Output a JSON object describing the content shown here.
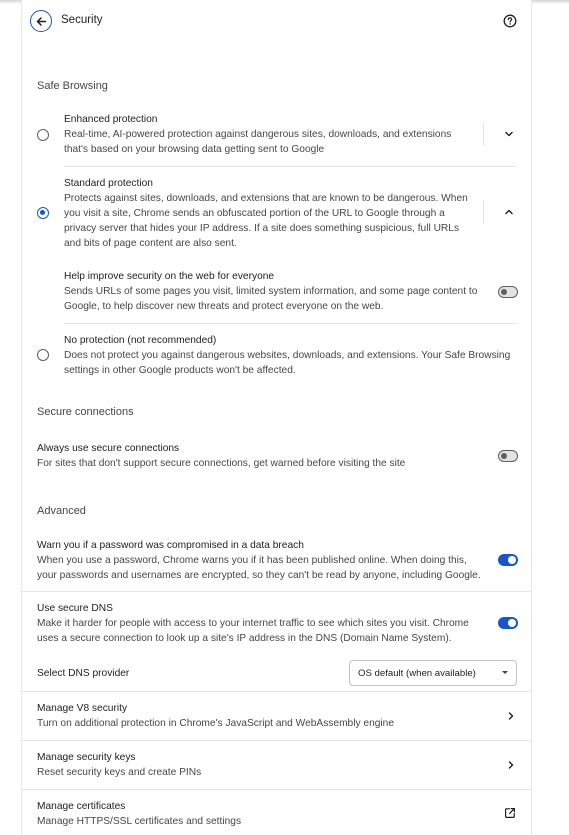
{
  "header": {
    "title": "Security",
    "back_icon": "arrow-back-icon",
    "help_icon": "help-circle-icon"
  },
  "safe_browsing": {
    "section_title": "Safe Browsing",
    "enhanced": {
      "label": "Enhanced protection",
      "description_line1": "Real-time, AI-powered protection against dangerous sites, downloads, and extensions",
      "description_line2": "that's based on your browsing data getting sent to Google",
      "selected": false,
      "expand_icon": "chevron-down-icon"
    },
    "standard": {
      "label": "Standard protection",
      "description_line1": "Protects against sites, downloads, and extensions that are known to be dangerous. When",
      "description_line2": "you visit a site, Chrome sends an obfuscated portion of the URL to Google through a",
      "description_line3": "privacy server that hides your IP address. If a site does something suspicious, full URLs",
      "description_line4": "and bits of page content are also sent.",
      "selected": true,
      "expand_icon": "chevron-up-icon"
    },
    "help_improve": {
      "label": "Help improve security on the web for everyone",
      "description_line1": "Sends URLs of some pages you visit, limited system information, and some page content to",
      "description_line2": "Google, to help discover new threats and protect everyone on the web.",
      "enabled": false
    },
    "no_protection": {
      "label": "No protection (not recommended)",
      "description_line1": "Does not protect you against dangerous websites, downloads, and extensions. Your Safe Browsing",
      "description_line2": "settings in other Google products won't be affected.",
      "selected": false
    }
  },
  "secure_connections": {
    "section_title": "Secure connections",
    "always_secure": {
      "label": "Always use secure connections",
      "description": "For sites that don't support secure connections, get warned before visiting the site",
      "enabled": false
    }
  },
  "advanced": {
    "section_title": "Advanced",
    "password_warning": {
      "label": "Warn you if a password was compromised in a data breach",
      "description_line1": "When you use a password, Chrome warns you if it has been published online. When doing this,",
      "description_line2": "your passwords and usernames are encrypted, so they can't be read by anyone, including Google.",
      "enabled": true
    },
    "secure_dns": {
      "label": "Use secure DNS",
      "description_line1": "Make it harder for people with access to your internet traffic to see which sites you visit. Chrome",
      "description_line2": "uses a secure connection to look up a site's IP address in the DNS (Domain Name System).",
      "enabled": true
    },
    "dns_provider": {
      "label": "Select DNS provider",
      "selected_value": "OS default (when available)"
    },
    "v8_security": {
      "label": "Manage V8 security",
      "description": "Turn on additional protection in Chrome's JavaScript and WebAssembly engine",
      "icon": "chevron-right-icon"
    },
    "security_keys": {
      "label": "Manage security keys",
      "description": "Reset security keys and create PINs",
      "icon": "chevron-right-icon"
    },
    "certificates": {
      "label": "Manage certificates",
      "description": "Manage HTTPS/SSL certificates and settings",
      "icon": "open-in-new-icon"
    }
  },
  "colors": {
    "accent": "#1a56c8",
    "text_primary": "#1f1f1f",
    "text_secondary": "#474747",
    "divider": "#e4e4e4"
  }
}
